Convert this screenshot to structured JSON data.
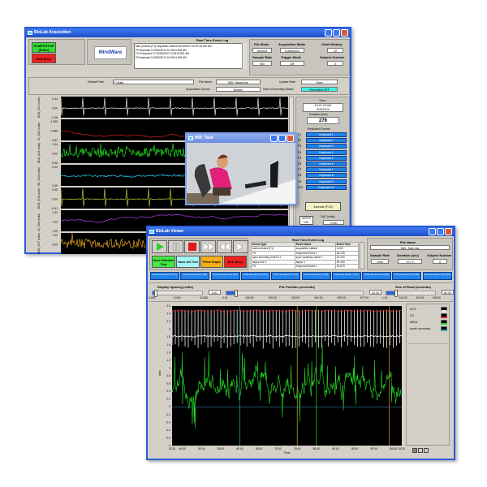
{
  "acq": {
    "title": "BioLab Acquisition",
    "start_stop": "START/STOP (Enter)",
    "exit": "Exit (Esc)",
    "logo": "MindWare",
    "event_log_title": "Real Time Event Log",
    "event_log": [
      "start pressed (F1) acquisition started 03/30/2010 10:02:48.516 AM",
      "F5 Keyboard 5 03/30/2010 10:05:51.826 AM",
      "F10 Keyboard 10 03/30/2010 10:05:53.811 AM",
      "F5 Keyboard 5 03/30/2010 10:06:44.536 AM"
    ],
    "file_mode_label": "File Mode",
    "file_mode": "Append",
    "acq_mode_label": "Acquisition Mode",
    "acq_mode": "Continuous",
    "chart_history_label": "Chart History",
    "chart_history": "10",
    "sample_rate_label": "Sample Rate",
    "sample_rate": "500",
    "trigger_mode_label": "Trigger Mode",
    "trigger_mode": "Off",
    "subject_label": "Subject Number",
    "subject": "0",
    "default_path_label": "Default Path",
    "default_path": "C:\\Data",
    "file_name_label": "File Name",
    "file_name": "MW_Mixed.mw",
    "update_rate_label": "Update Rate",
    "update_rate": "1/sec",
    "acq_source_label": "Acquisition Source",
    "acq_source": "BioNex",
    "video_status_label": "Video Recording Status",
    "video_status": "Recording OFF",
    "time_label": "Time",
    "time": "10:07:25 AM",
    "date": "3/30/2010",
    "duration_label": "Duration (sec)",
    "duration": "276",
    "kb_events_label": "Keyboard Events",
    "kb_keys": [
      "F1",
      "F2",
      "F3",
      "F4",
      "F5",
      "F6",
      "F7",
      "F8",
      "F9",
      "F10"
    ],
    "kb_events": [
      "Keyboard 1",
      "Keyboard 2",
      "Keyboard 3",
      "Keyboard 4",
      "Keyboard 5",
      "Keyboard 6",
      "Keyboard 7",
      "Keyboard 8",
      "Keyboard 9",
      "Keyboard 10"
    ],
    "journal": "Journal (F12)",
    "write_dat": "WRITE DAT",
    "dat_label": "DAT (volts)",
    "dat_value": "0.000",
    "channels": [
      {
        "label": "ECG_Ch1 (volts)",
        "ticks": [
          "0.44",
          "0.00",
          "-0.28"
        ],
        "color": "#e8e8e8",
        "kind": "ecg"
      },
      {
        "label": "Z0_Ch2 (volts)",
        "ticks": [
          "1.000",
          "0.985",
          "0.97"
        ],
        "color": "#e02020",
        "kind": "slow"
      },
      {
        "label": "EDA_Ch3 (volts)",
        "ticks": [
          "1.04",
          "0.00",
          "-0.96"
        ],
        "color": "#20e020",
        "kind": "noise"
      },
      {
        "label": "SC_Ch4 (volts)",
        "ticks": [
          "0.10",
          "",
          "0.09"
        ],
        "color": "#30c8f0",
        "kind": "drift"
      },
      {
        "label": "ECG_Ch5 (volts)",
        "ticks": [
          "0.45",
          "0.00",
          "-0.41"
        ],
        "color": "#b8c840",
        "kind": "ecg"
      },
      {
        "label": "Z0_Ch6 (volts)",
        "ticks": [
          "1.03",
          "1.02",
          "1.00"
        ],
        "color": "#b040e0",
        "kind": "slow"
      },
      {
        "label": "EMG_Ch7 (volts)",
        "ticks": [
          "1.00",
          "0.00",
          ""
        ],
        "color": "#e0a020",
        "kind": "noise"
      }
    ]
  },
  "video": {
    "title": "MW_Task"
  },
  "viewer": {
    "title": "BioLab Viewer",
    "save_window": "Save Window Text",
    "save_all": "Save All Text",
    "print": "Print Graph",
    "exit": "Exit (Esc)",
    "event_log_title": "Real Time Event Log",
    "columns": [
      "Event Type",
      "Event Name",
      "Event Time"
    ],
    "rows": [
      [
        "start pressed (F1)",
        "acquisition started",
        "0.000"
      ],
      [
        "F5",
        "Keyboard Event 1",
        "28.125"
      ],
      [
        "sync summary event # 1",
        "sync summary name 1",
        "40.000"
      ],
      [
        "async line 1",
        "async 1",
        "59.400"
      ],
      [
        "F5",
        "Keyboard Event 1",
        "78.875"
      ]
    ],
    "file_name_label": "File Name",
    "file_name": "MW_Task.mw",
    "sample_rate_label": "Sample Rate",
    "sample_rate": "1000",
    "duration_label": "Duration (sec)",
    "duration": "577.9",
    "subject_label": "Subject Number",
    "subject": "0",
    "post_events": [
      "Post-Arq Event 1 (F1)",
      "Post-Arq Event 2 (F2)",
      "Post-Arq Event 3 (F3)",
      "Post-Arq Event 4 (F4)",
      "Post-Arq Event 5 (F5)",
      "Post-Arq Event 6 (F6)",
      "Post-Arq Event 7 (F7)",
      "Post-Arq Event 8 (F8)",
      "Post-Arq Event 9 (F9)",
      "Post-Arq Event 10 (F10)"
    ],
    "spacing_label": "Display Spacing (volts)",
    "spacing_value": "0.61",
    "spacing_fraction": 0.06,
    "spacing_ticks": [
      "0.000",
      "5.000",
      "10.000"
    ],
    "position_label": "File Position (seconds)",
    "position_value": "42.30",
    "position_fraction": 0.07,
    "position_ticks": [
      "0.00",
      "100.00",
      "200.00",
      "300.00",
      "400.00",
      "500.00",
      "577.90"
    ],
    "read_label": "Size of Read (seconds)",
    "read_value": "60.00",
    "read_fraction": 0.2,
    "read_ticks": [
      "1.00",
      "100.00",
      "200.00",
      "300.00"
    ],
    "y_label": "volts",
    "x_label": "Time",
    "y_ticks": [
      "2.6",
      "2.4",
      "2.2",
      "2",
      "1.8",
      "1.6",
      "1.4",
      "1.2",
      "1",
      "0.8",
      "0.6",
      "0.4",
      "0.2",
      "0",
      "-0.2",
      "-0.4",
      "-0.6",
      "-0.8",
      "-1"
    ],
    "x_ticks": [
      "42.30",
      "45.00",
      "50.00",
      "55.00",
      "60.00",
      "65.00",
      "70.00",
      "75.00",
      "80.00",
      "85.00",
      "90.00",
      "95.00",
      "100.00",
      "102.30"
    ],
    "legend": [
      {
        "name": "ECG",
        "color": "#e8e8e8"
      },
      {
        "name": "ZO",
        "color": "#e02020"
      },
      {
        "name": "dEDA",
        "color": "#20e020"
      },
      {
        "name": "synch summary",
        "color": "#30a8d0"
      }
    ],
    "markers": [
      {
        "t": 60,
        "color": "#2090a8"
      },
      {
        "t": 75,
        "color": "#b0a020"
      },
      {
        "t": 80,
        "color": "#40c020"
      },
      {
        "t": 99,
        "color": "#c08020"
      }
    ]
  }
}
